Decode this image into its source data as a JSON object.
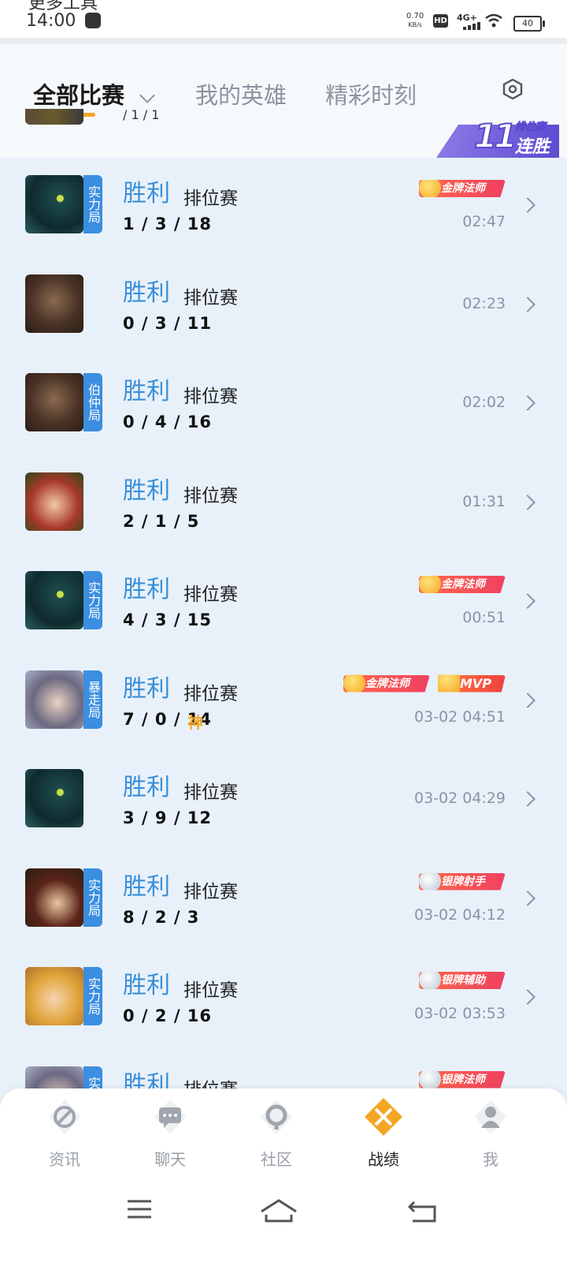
{
  "status_bar": {
    "partial_text": "更多工具",
    "time": "14:00",
    "net_speed_value": "0.70",
    "net_speed_unit": "KB/s",
    "hd": "HD",
    "network": "4G+",
    "battery": "40"
  },
  "header": {
    "tabs": [
      {
        "label": "全部比赛"
      },
      {
        "label": "我的英雄"
      },
      {
        "label": "精彩时刻"
      }
    ],
    "partial_row_kda": "/ 1 / 1",
    "streak": {
      "count": "11",
      "top_label": "排位赛",
      "bottom_label": "连胜"
    }
  },
  "matches": [
    {
      "result": "胜利",
      "mode": "排位赛",
      "kda": "1 / 3 / 18",
      "time": "02:47",
      "tag": "实力局",
      "badges": [
        {
          "label": "金牌法师",
          "kind": "gold"
        }
      ]
    },
    {
      "result": "胜利",
      "mode": "排位赛",
      "kda": "0 / 3 / 11",
      "time": "02:23",
      "tag": "",
      "badges": []
    },
    {
      "result": "胜利",
      "mode": "排位赛",
      "kda": "0 / 4 / 16",
      "time": "02:02",
      "tag": "伯仲局",
      "badges": []
    },
    {
      "result": "胜利",
      "mode": "排位赛",
      "kda": "2 / 1 / 5",
      "time": "01:31",
      "tag": "",
      "badges": []
    },
    {
      "result": "胜利",
      "mode": "排位赛",
      "kda": "4 / 3 / 15",
      "time": "00:51",
      "tag": "实力局",
      "badges": [
        {
          "label": "金牌法师",
          "kind": "gold"
        }
      ]
    },
    {
      "result": "胜利",
      "mode": "排位赛",
      "kda": "7 / 0 / 14",
      "god": "神",
      "time": "03-02 04:51",
      "tag": "暴走局",
      "badges": [
        {
          "label": "金牌法师",
          "kind": "gold"
        },
        {
          "label": "MVP",
          "kind": "mvp"
        }
      ]
    },
    {
      "result": "胜利",
      "mode": "排位赛",
      "kda": "3 / 9 / 12",
      "time": "03-02 04:29",
      "tag": "",
      "badges": []
    },
    {
      "result": "胜利",
      "mode": "排位赛",
      "kda": "8 / 2 / 3",
      "time": "03-02 04:12",
      "tag": "实力局",
      "badges": [
        {
          "label": "银牌射手",
          "kind": "silver"
        }
      ]
    },
    {
      "result": "胜利",
      "mode": "排位赛",
      "kda": "0 / 2 / 16",
      "time": "03-02 03:53",
      "tag": "实力局",
      "badges": [
        {
          "label": "银牌辅助",
          "kind": "silver"
        }
      ]
    },
    {
      "result": "胜利",
      "mode": "排位赛",
      "kda": "",
      "time": "",
      "tag": "实力局",
      "badges": [
        {
          "label": "银牌法师",
          "kind": "silver"
        }
      ]
    }
  ],
  "avatars": [
    "robot",
    "bull",
    "bull",
    "girl-red",
    "robot",
    "woman-silver",
    "robot",
    "cowboy",
    "blonde",
    "woman-silver"
  ],
  "bottom_nav": [
    {
      "label": "资讯",
      "icon": "news-icon"
    },
    {
      "label": "聊天",
      "icon": "chat-icon"
    },
    {
      "label": "社区",
      "icon": "community-icon"
    },
    {
      "label": "战绩",
      "icon": "record-icon",
      "active": true
    },
    {
      "label": "我",
      "icon": "profile-icon"
    }
  ],
  "colors": {
    "accent": "#3a8fd8",
    "active_tab_underline": "#f5a623",
    "nav_active": "#f5a623"
  }
}
